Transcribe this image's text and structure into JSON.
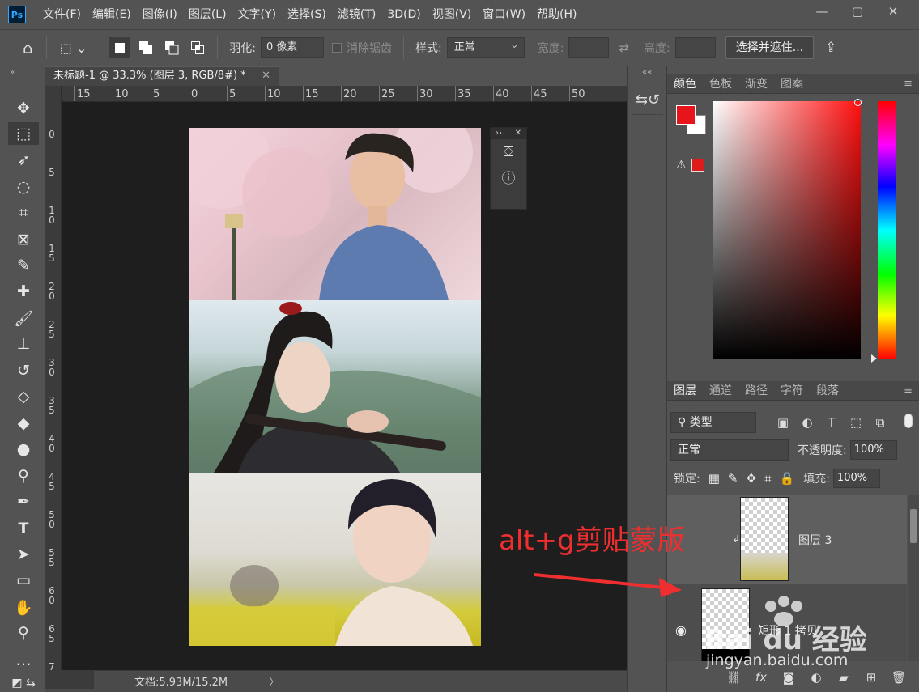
{
  "app": {
    "logo": "Ps"
  },
  "menu": [
    "文件(F)",
    "编辑(E)",
    "图像(I)",
    "图层(L)",
    "文字(Y)",
    "选择(S)",
    "滤镜(T)",
    "3D(D)",
    "视图(V)",
    "窗口(W)",
    "帮助(H)"
  ],
  "window_controls": {
    "minimize": "—",
    "restore": "▢",
    "close": "✕"
  },
  "options": {
    "feather_label": "羽化:",
    "feather_value": "0 像素",
    "antialias_label": "消除锯齿",
    "style_label": "样式:",
    "style_value": "正常",
    "width_label": "宽度:",
    "height_label": "高度:",
    "select_mask_button": "选择并遮住..."
  },
  "document": {
    "tab_title": "未标题-1 @ 33.3% (图层 3, RGB/8#) *",
    "tab_close": "✕",
    "status_text": "文档:5.93M/15.2M",
    "status_arrow": "〉"
  },
  "ruler_h": [
    "15",
    "10",
    "5",
    "0",
    "5",
    "10",
    "15",
    "20",
    "25",
    "30",
    "35",
    "40",
    "45",
    "50"
  ],
  "ruler_v": [
    "0",
    "5",
    "1 0",
    "1 5",
    "2 0",
    "2 5",
    "3 0",
    "3 5",
    "4 0",
    "4 5",
    "5 0",
    "5 5",
    "6 0",
    "6 5",
    "7"
  ],
  "color_panel": {
    "tabs": [
      "颜色",
      "色板",
      "渐变",
      "图案"
    ],
    "active_tab": "颜色",
    "foreground": "#e8141c",
    "background": "#ffffff",
    "gamut_warning_icon": "⚠"
  },
  "layers_panel": {
    "tabs": [
      "图层",
      "通道",
      "路径",
      "字符",
      "段落"
    ],
    "filter_kind": "类型",
    "blend_mode": "正常",
    "opacity_label": "不透明度:",
    "opacity_value": "100%",
    "lock_label": "锁定:",
    "fill_label": "填充:",
    "fill_value": "100%",
    "layers": [
      {
        "name": "图层 3",
        "clipped": true,
        "selected": true
      },
      {
        "name": "矩形 1 拷贝",
        "clipped": false,
        "selected": false
      }
    ]
  },
  "annotation": {
    "text": "alt+g剪贴蒙版",
    "color": "#ef2f2f"
  },
  "watermark": {
    "text": "Bai du 经验",
    "url": "jingyan.baidu.com"
  }
}
